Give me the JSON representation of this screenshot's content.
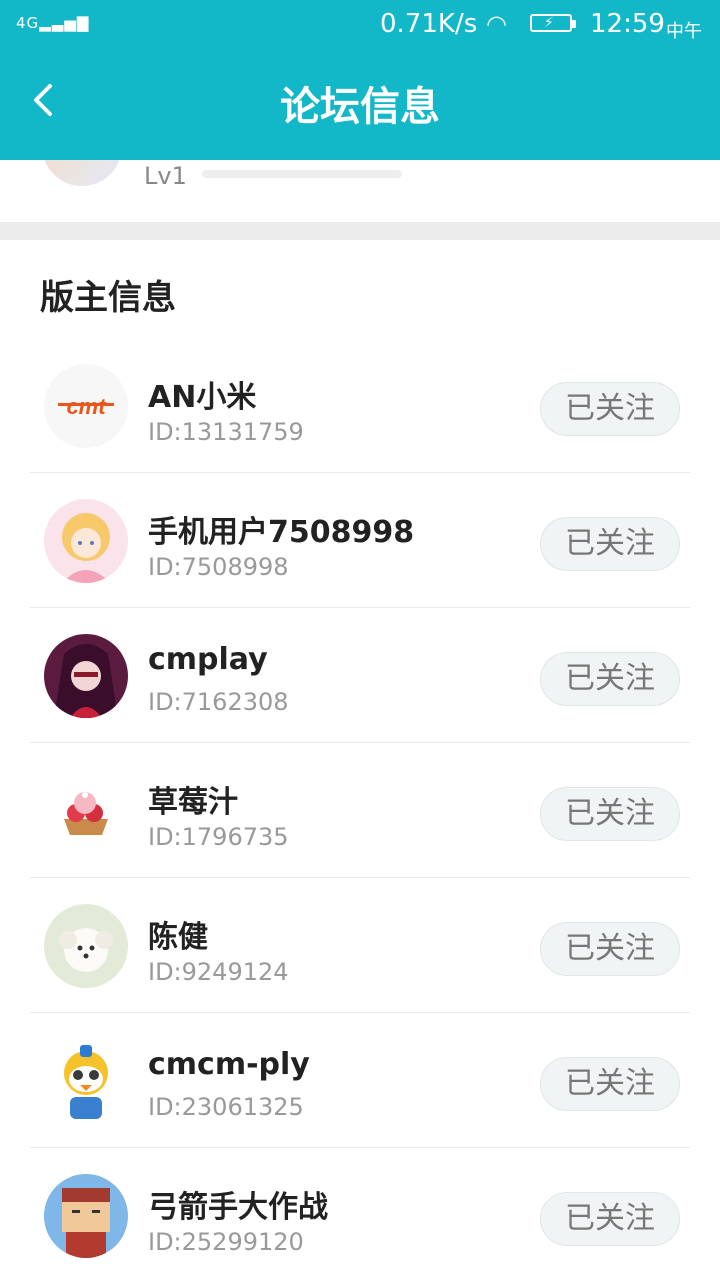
{
  "status_bar": {
    "network": "4G",
    "speed": "0.71K/s",
    "time": "12:59",
    "period": "中午"
  },
  "header": {
    "title": "论坛信息"
  },
  "profile": {
    "level": "Lv1",
    "level_progress": 0.0
  },
  "section": {
    "title": "版主信息"
  },
  "moderators": [
    {
      "name": "AN小米",
      "id": "ID:13131759",
      "button": "已关注",
      "avatar": "cmt-logo"
    },
    {
      "name": "手机用户7508998",
      "id": "ID:7508998",
      "button": "已关注",
      "avatar": "anime-girl-blonde"
    },
    {
      "name": "cmplay",
      "id": "ID:7162308",
      "button": "已关注",
      "avatar": "anime-girl-purple"
    },
    {
      "name": "草莓汁",
      "id": "ID:1796735",
      "button": "已关注",
      "avatar": "strawberry-tart"
    },
    {
      "name": "陈健",
      "id": "ID:9249124",
      "button": "已关注",
      "avatar": "white-puppy"
    },
    {
      "name": "cmcm-ply",
      "id": "ID:23061325",
      "button": "已关注",
      "avatar": "pororo-penguin"
    },
    {
      "name": "弓箭手大作战",
      "id": "ID:25299120",
      "button": "已关注",
      "avatar": "blocky-character"
    }
  ],
  "colors": {
    "accent": "#13b8c8",
    "divider": "#ececec"
  }
}
